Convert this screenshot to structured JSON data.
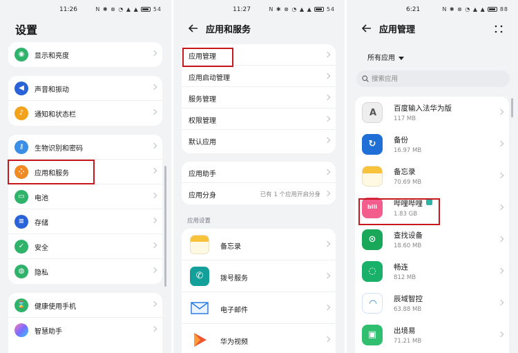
{
  "panel1": {
    "status": {
      "time": "11:26",
      "icons": "N ✱ ⊗ ◔ ▲ ▲",
      "battery": "54"
    },
    "title": "设置",
    "card_a": [
      {
        "label": "显示和亮度",
        "icon": "eye-icon"
      }
    ],
    "card_b": [
      {
        "label": "声音和振动",
        "icon": "speaker-icon"
      },
      {
        "label": "通知和状态栏",
        "icon": "bell-icon"
      }
    ],
    "card_c": [
      {
        "label": "生物识别和密码",
        "icon": "key-icon"
      },
      {
        "label": "应用和服务",
        "icon": "apps-grid-icon"
      },
      {
        "label": "电池",
        "icon": "battery-icon"
      },
      {
        "label": "存储",
        "icon": "storage-icon"
      },
      {
        "label": "安全",
        "icon": "shield-icon"
      },
      {
        "label": "隐私",
        "icon": "privacy-icon"
      }
    ],
    "card_d": [
      {
        "label": "健康使用手机",
        "icon": "hourglass-icon"
      },
      {
        "label": "智慧助手",
        "icon": "assistant-icon"
      }
    ]
  },
  "panel2": {
    "status": {
      "time": "11:27",
      "icons": "N ✱ ⊗ ◔ ▲ ▲",
      "battery": "54"
    },
    "title": "应用和服务",
    "card_a": [
      "应用管理",
      "应用启动管理",
      "服务管理",
      "权限管理",
      "默认应用"
    ],
    "card_b": [
      {
        "label": "应用助手",
        "hint": ""
      },
      {
        "label": "应用分身",
        "hint": "已有 1 个应用开启分身"
      }
    ],
    "section": "应用设置",
    "card_c": [
      {
        "label": "备忘录",
        "icon": "notes-icon"
      },
      {
        "label": "拨号服务",
        "icon": "phone-icon"
      },
      {
        "label": "电子邮件",
        "icon": "mail-icon"
      },
      {
        "label": "华为视频",
        "icon": "video-icon"
      }
    ]
  },
  "panel3": {
    "status": {
      "time": "6:21",
      "icons": "N ✱ ⊗ ◔ ▲ ▲",
      "battery": "88"
    },
    "title": "应用管理",
    "filter": "所有应用",
    "search_placeholder": "搜索应用",
    "apps": [
      {
        "name": "百度输入法华为版",
        "size": "117 MB",
        "icon": "baidu-ime-icon"
      },
      {
        "name": "备份",
        "size": "16.97 MB",
        "icon": "backup-icon"
      },
      {
        "name": "备忘录",
        "size": "70.69 MB",
        "icon": "notes-icon"
      },
      {
        "name": "哔哩哔哩",
        "size": "1.83 GB",
        "icon": "bilibili-icon"
      },
      {
        "name": "查找设备",
        "size": "18.60 MB",
        "icon": "find-device-icon"
      },
      {
        "name": "畅连",
        "size": "812 MB",
        "icon": "meetime-icon"
      },
      {
        "name": "辰域智控",
        "size": "63.88 MB",
        "icon": "smart-control-icon"
      },
      {
        "name": "出境易",
        "size": "71.21 MB",
        "icon": "travel-icon"
      }
    ]
  },
  "colors": {
    "highlight": "#c8161d",
    "background": "#f1f3f5",
    "card": "#ffffff"
  }
}
